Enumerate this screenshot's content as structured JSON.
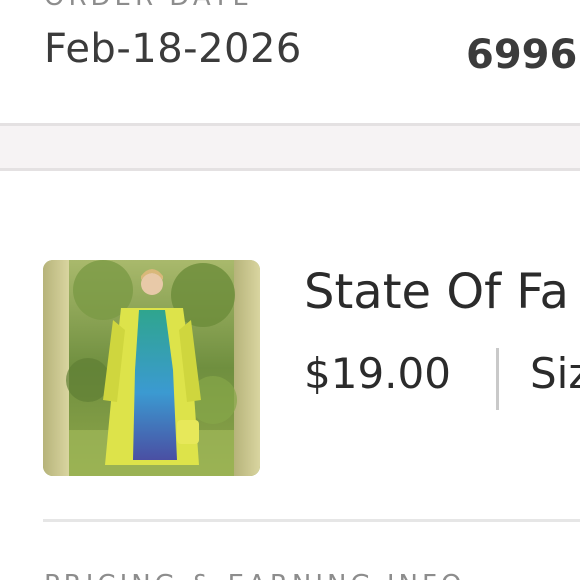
{
  "order": {
    "date_label": "ORDER DATE",
    "date_value": "Feb-18-2026",
    "number_value": "6996"
  },
  "item": {
    "title": "State Of Fa",
    "price": "$19.00",
    "size_label": "Siz",
    "image_icon": "product-photo"
  },
  "section": {
    "heading": "PRICING & EARNING INFO"
  },
  "colors": {
    "band": "#f6f3f4",
    "divider": "#e4e1e2",
    "text": "#2b2b2b",
    "muted": "#8d8d8d"
  }
}
